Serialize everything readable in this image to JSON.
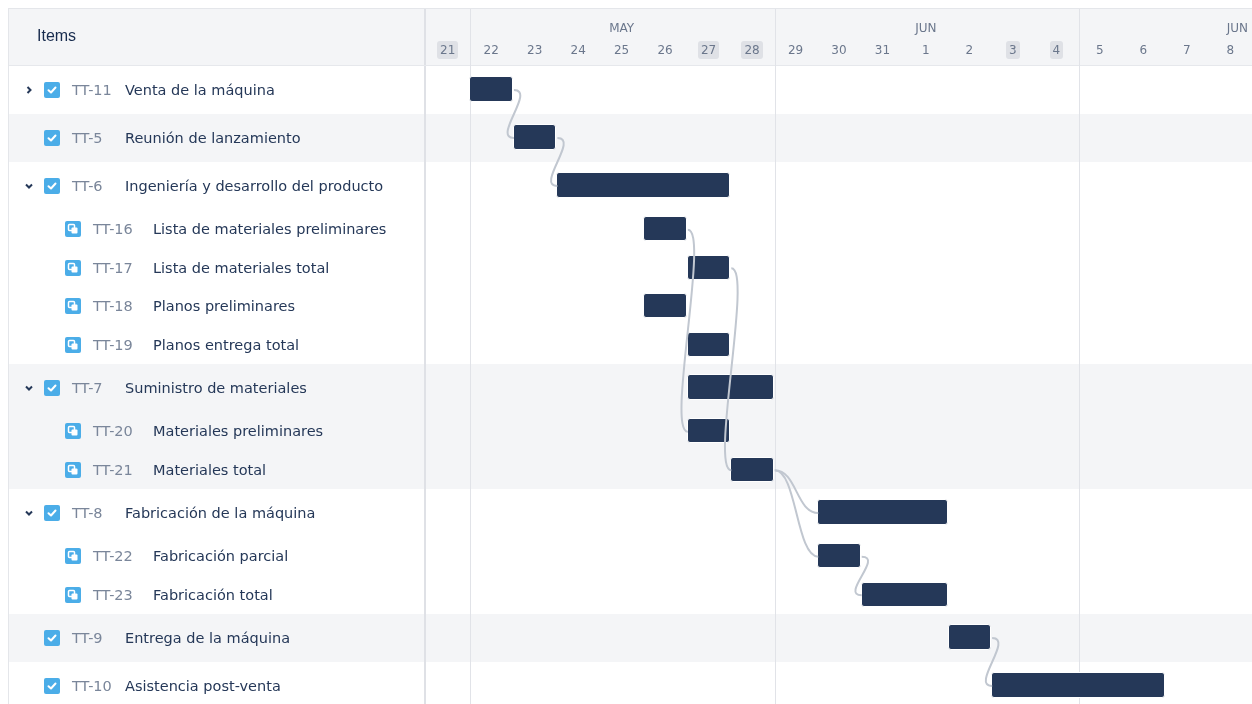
{
  "header": {
    "items_label": "Items"
  },
  "weeks": [
    {
      "days": [
        {
          "label": "21",
          "weekend": true
        }
      ]
    },
    {
      "month": "MAY",
      "days": [
        {
          "label": "22",
          "weekend": false
        },
        {
          "label": "23",
          "weekend": false
        },
        {
          "label": "24",
          "weekend": false
        },
        {
          "label": "25",
          "weekend": false
        },
        {
          "label": "26",
          "weekend": false
        },
        {
          "label": "27",
          "weekend": true
        },
        {
          "label": "28",
          "weekend": true
        }
      ]
    },
    {
      "month": "JUN",
      "days": [
        {
          "label": "29",
          "weekend": false
        },
        {
          "label": "30",
          "weekend": false
        },
        {
          "label": "31",
          "weekend": false
        },
        {
          "label": "1",
          "weekend": false
        },
        {
          "label": "2",
          "weekend": false
        },
        {
          "label": "3",
          "weekend": true
        },
        {
          "label": "4",
          "weekend": true
        }
      ]
    },
    {
      "month": "JUN",
      "days": [
        {
          "label": "5",
          "weekend": false
        },
        {
          "label": "6",
          "weekend": false
        },
        {
          "label": "7",
          "weekend": false
        },
        {
          "label": "8",
          "weekend": false
        }
      ]
    }
  ],
  "items": [
    {
      "key": "TT-11",
      "title": "Venta de la máquina",
      "kind": "task",
      "expanded": false
    },
    {
      "key": "TT-5",
      "title": "Reunión de lanzamiento",
      "kind": "task"
    },
    {
      "key": "TT-6",
      "title": "Ingeniería y desarrollo del producto",
      "kind": "task",
      "expanded": true,
      "children": [
        {
          "key": "TT-16",
          "title": "Lista de materiales preliminares",
          "kind": "subtask"
        },
        {
          "key": "TT-17",
          "title": "Lista de materiales total",
          "kind": "subtask"
        },
        {
          "key": "TT-18",
          "title": "Planos preliminares",
          "kind": "subtask"
        },
        {
          "key": "TT-19",
          "title": "Planos entrega total",
          "kind": "subtask"
        }
      ]
    },
    {
      "key": "TT-7",
      "title": "Suministro de materiales",
      "kind": "task",
      "expanded": true,
      "children": [
        {
          "key": "TT-20",
          "title": "Materiales preliminares",
          "kind": "subtask"
        },
        {
          "key": "TT-21",
          "title": "Materiales total",
          "kind": "subtask"
        }
      ]
    },
    {
      "key": "TT-8",
      "title": "Fabricación de la máquina",
      "kind": "task",
      "expanded": true,
      "children": [
        {
          "key": "TT-22",
          "title": "Fabricación parcial",
          "kind": "subtask"
        },
        {
          "key": "TT-23",
          "title": "Fabricación total",
          "kind": "subtask"
        }
      ]
    },
    {
      "key": "TT-9",
      "title": "Entrega de la máquina",
      "kind": "task"
    },
    {
      "key": "TT-10",
      "title": "Asistencia post-venta",
      "kind": "task"
    }
  ]
}
